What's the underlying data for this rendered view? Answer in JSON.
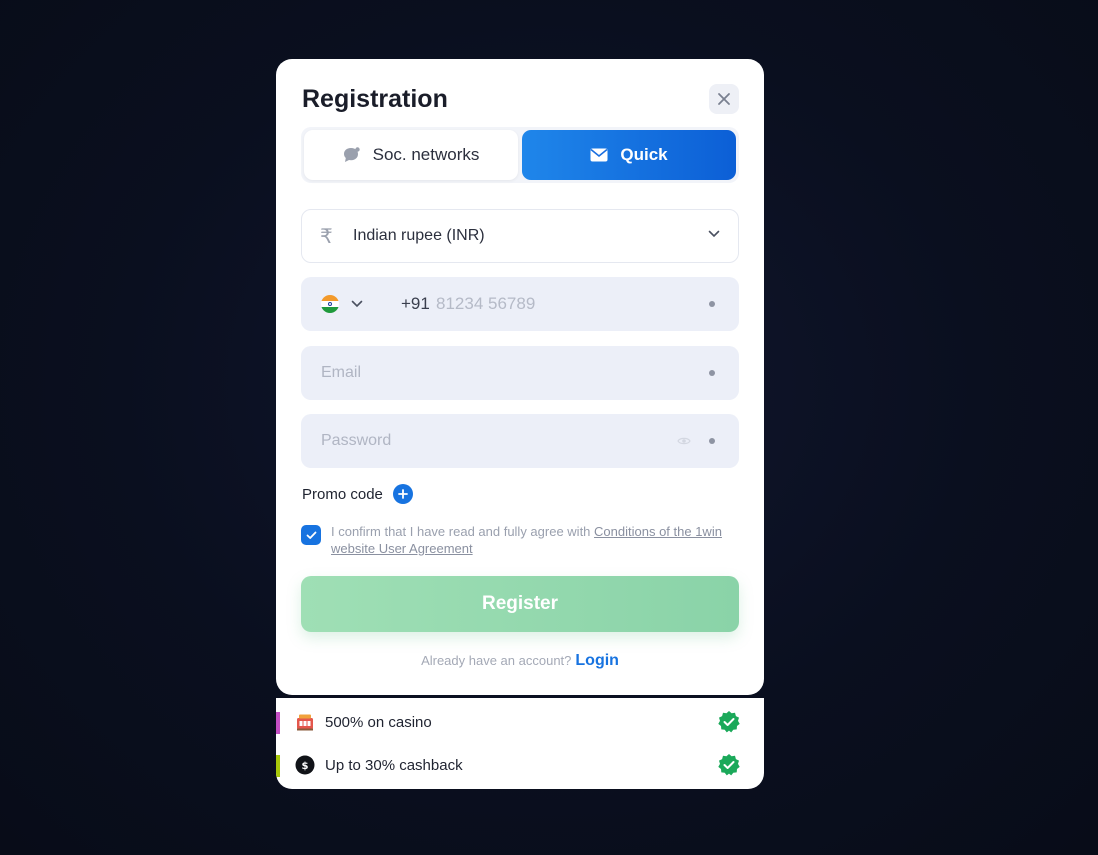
{
  "modal": {
    "title": "Registration",
    "close_icon": "close-icon"
  },
  "tabs": [
    {
      "label": "Soc. networks",
      "icon": "chat-bubble-icon",
      "active": false
    },
    {
      "label": "Quick",
      "icon": "envelope-icon",
      "active": true
    }
  ],
  "currency": {
    "icon": "rupee-icon",
    "symbol": "₹",
    "value": "Indian rupee (INR)"
  },
  "phone": {
    "flag": "india-flag-icon",
    "country_code": "+91",
    "placeholder": "81234 56789"
  },
  "email": {
    "placeholder": "Email"
  },
  "password": {
    "placeholder": "Password"
  },
  "promo": {
    "label": "Promo code"
  },
  "agreement": {
    "text": "I confirm that I have read and fully agree with ",
    "link": "Conditions of the 1win website User Agreement",
    "checked": true
  },
  "register_button": {
    "label": "Register"
  },
  "login": {
    "prompt": "Already have an account?",
    "link": "Login"
  },
  "bonuses": [
    {
      "text": "500% on casino",
      "icon": "casino-icon",
      "accent": "#c44fc4",
      "checked": true
    },
    {
      "text": "Up to 30% cashback",
      "icon": "cashback-icon",
      "accent": "#a8c80a",
      "checked": true
    }
  ],
  "colors": {
    "primary_blue": "#1773e0",
    "register_green": "#8ad3a8",
    "check_green": "#1ba95a",
    "field_bg": "#eceff8"
  }
}
